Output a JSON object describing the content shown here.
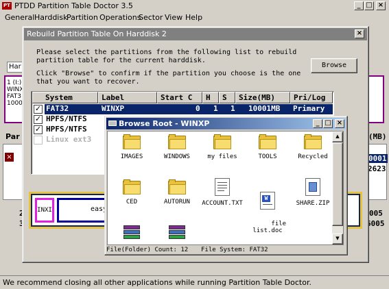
{
  "app": {
    "title": "PTDD Partition Table Doctor 3.5",
    "menu": [
      "General",
      "Harddisk",
      "Partition",
      "Operations",
      "Sector",
      "View",
      "Help"
    ]
  },
  "background": {
    "tab_label": "Har",
    "left_panel_lines": [
      "1 (I:)",
      "WINX",
      "FAT3",
      "1000"
    ],
    "par_label": "Par",
    "mb_label": "(MB)",
    "right_numbers": [
      "0001",
      "2623"
    ],
    "bottom_left": [
      "2",
      "3"
    ],
    "bottom_right": [
      "005",
      "6005"
    ],
    "strip_label": "INXI",
    "strip_text": "easy"
  },
  "dialog": {
    "title": "Rebuild Partition Table On Harddisk 2",
    "instructions_1": "Please select the partitions from the following list to rebuild\npartition table for the current harddisk.",
    "instructions_2": "Click \"Browse\" to confirm if the partition you choose is the one\nthat you want to recover.",
    "browse_button": "Browse",
    "columns": [
      "System",
      "Label",
      "Start C",
      "H",
      "S",
      "Size(MB)",
      "Pri/Log"
    ],
    "rows": [
      {
        "checked": true,
        "system": "FAT32",
        "label": "WINXP",
        "start_c": "0",
        "h": "1",
        "s": "1",
        "size": "10001MB",
        "type": "Primary",
        "selected": true
      },
      {
        "checked": true,
        "system": "HPFS/NTFS",
        "label": "",
        "start_c": "",
        "h": "",
        "s": "",
        "size": "",
        "type": "",
        "selected": false
      },
      {
        "checked": true,
        "system": "HPFS/NTFS",
        "label": "",
        "start_c": "",
        "h": "",
        "s": "",
        "size": "",
        "type": "",
        "selected": false
      },
      {
        "checked": false,
        "system": "Linux ext3",
        "label": "",
        "start_c": "",
        "h": "",
        "s": "",
        "size": "",
        "type": "",
        "selected": false
      }
    ]
  },
  "browse_window": {
    "title": "Browse Root - WINXP",
    "items": [
      {
        "name": "IMAGES",
        "icon": "folder-icon"
      },
      {
        "name": "WINDOWS",
        "icon": "folder-icon"
      },
      {
        "name": "my files",
        "icon": "folder-icon"
      },
      {
        "name": "TOOLS",
        "icon": "folder-icon"
      },
      {
        "name": "Recycled",
        "icon": "folder-icon"
      },
      {
        "name": "CED",
        "icon": "folder-icon"
      },
      {
        "name": "AUTORUN",
        "icon": "folder-icon"
      },
      {
        "name": "ACCOUNT.TXT",
        "icon": "text-file-icon"
      },
      {
        "name": "file\nlist.doc",
        "icon": "word-document-icon"
      },
      {
        "name": "SHARE.ZIP",
        "icon": "zip-file-icon"
      },
      {
        "name": "",
        "icon": "rar-archive-icon"
      },
      {
        "name": "",
        "icon": "rar-archive-icon"
      }
    ],
    "status_count_label": "File(Folder) Count: 12",
    "status_fs_label": "File System:  FAT32"
  },
  "status_bar": {
    "text": "We recommend closing all other applications while running Partition Table Doctor."
  },
  "colors": {
    "selection": "#0a246a",
    "window_bg": "#d4d0c8",
    "title_active": "#0a246a",
    "title_inactive": "#808080"
  }
}
